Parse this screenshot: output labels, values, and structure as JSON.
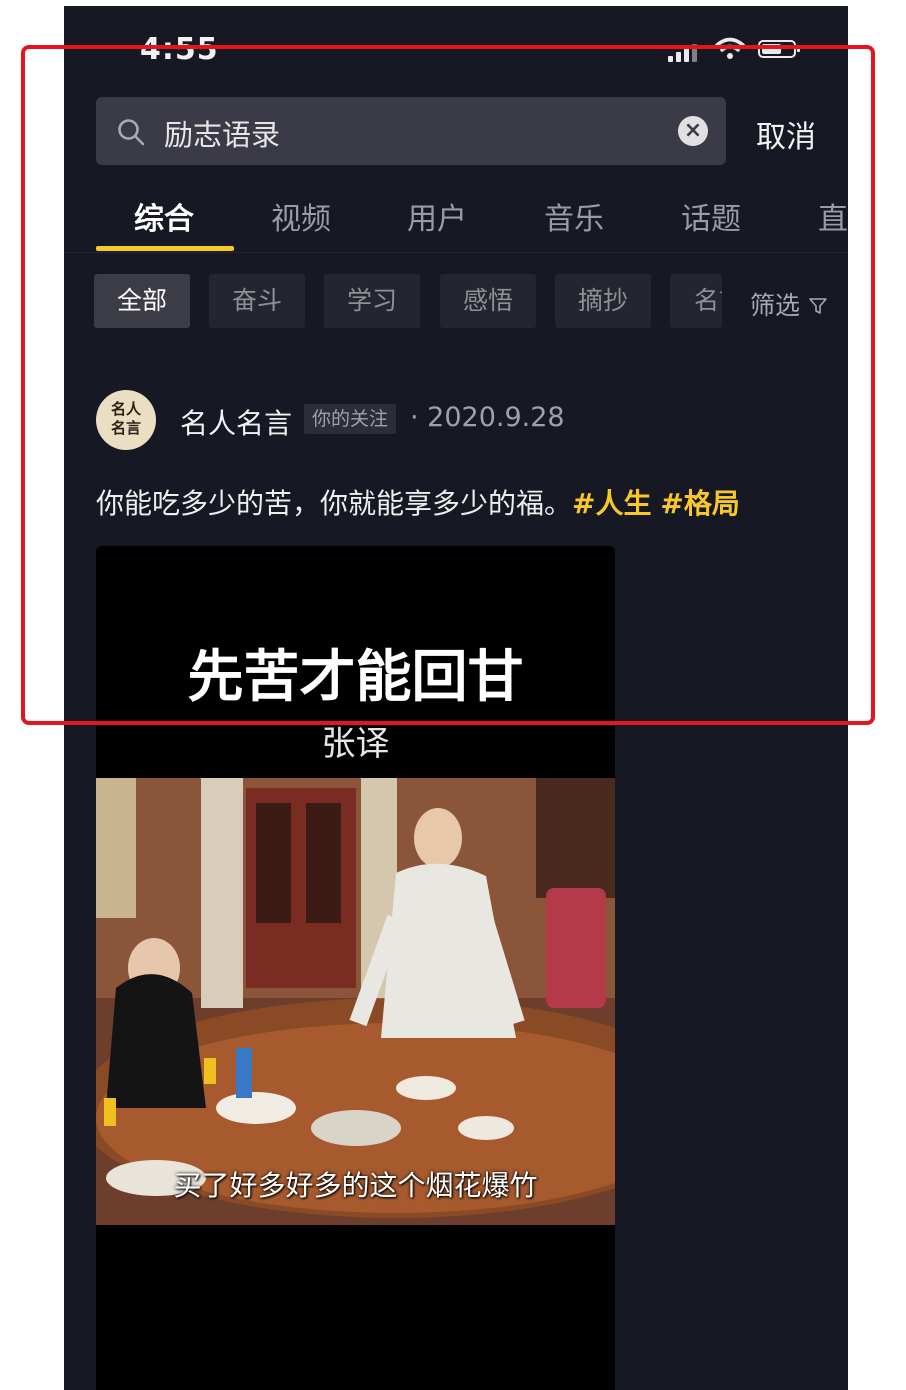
{
  "status_bar": {
    "time": "4:55"
  },
  "search": {
    "query": "励志语录",
    "cancel_label": "取消"
  },
  "tabs": [
    {
      "label": "综合",
      "active": true
    },
    {
      "label": "视频"
    },
    {
      "label": "用户"
    },
    {
      "label": "音乐"
    },
    {
      "label": "话题"
    },
    {
      "label": "直"
    }
  ],
  "chips": [
    {
      "label": "全部",
      "active": true
    },
    {
      "label": "奋斗"
    },
    {
      "label": "学习"
    },
    {
      "label": "感悟"
    },
    {
      "label": "摘抄"
    },
    {
      "label": "名言"
    }
  ],
  "filter_label": "筛选",
  "post": {
    "avatar_text": "名人名言",
    "author": "名人名言",
    "follow_tag": "你的关注",
    "date": "· 2020.9.28",
    "caption": "你能吃多少的苦，你就能享多少的福。",
    "hashtags": [
      "#人生",
      "#格局"
    ],
    "video": {
      "title": "先苦才能回甘",
      "subtitle_name": "张译",
      "caption": "买了好多好多的这个烟花爆竹"
    }
  },
  "colors": {
    "background": "#161823",
    "accent": "#f8c828",
    "highlight_border": "#e5141d"
  }
}
